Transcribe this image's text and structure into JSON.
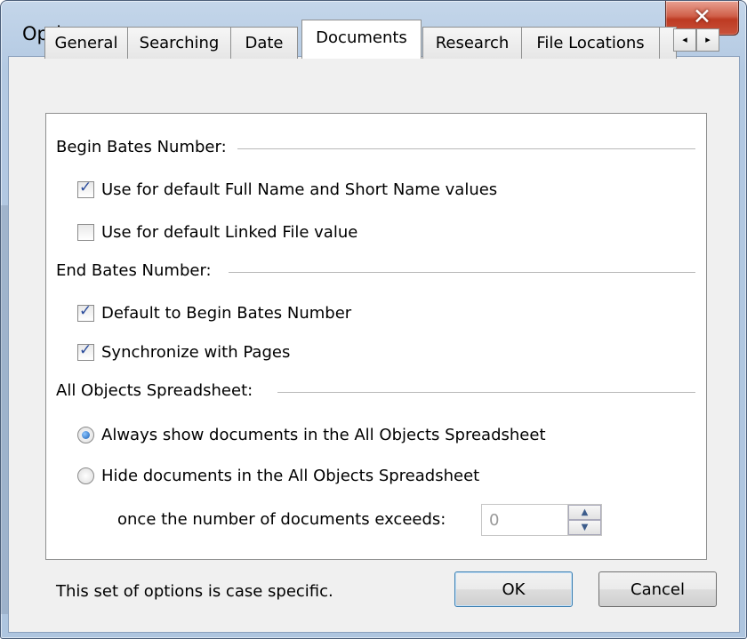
{
  "window": {
    "title": "Options",
    "close_icon_glyph": "✕"
  },
  "tabs": [
    {
      "label": "General",
      "active": false
    },
    {
      "label": "Searching",
      "active": false
    },
    {
      "label": "Date",
      "active": false
    },
    {
      "label": "Documents",
      "active": true
    },
    {
      "label": "Research",
      "active": false
    },
    {
      "label": "File Locations",
      "active": false
    }
  ],
  "tab_scroll": {
    "left_glyph": "◂",
    "right_glyph": "▸"
  },
  "begin_bates": {
    "heading": "Begin Bates Number:",
    "options": [
      {
        "label": "Use for default Full Name and Short Name values",
        "checked": true
      },
      {
        "label": "Use for default Linked File value",
        "checked": false
      }
    ]
  },
  "end_bates": {
    "heading": "End Bates Number:",
    "options": [
      {
        "label": "Default to Begin Bates Number",
        "checked": true
      },
      {
        "label": "Synchronize with Pages",
        "checked": true
      }
    ]
  },
  "all_objects": {
    "heading": "All Objects Spreadsheet:",
    "options": [
      {
        "label": "Always show documents in the All Objects Spreadsheet",
        "selected": true
      },
      {
        "label": "Hide documents in the All Objects Spreadsheet",
        "selected": false
      }
    ],
    "threshold_label": "once the number of documents exceeds:",
    "threshold_value": "0"
  },
  "footer": {
    "note": "This set of options is case specific.",
    "ok_label": "OK",
    "cancel_label": "Cancel"
  },
  "colors": {
    "frame": "#b3c9e2",
    "close_button": "#c9523b",
    "default_button_border": "#3c7fb1"
  }
}
